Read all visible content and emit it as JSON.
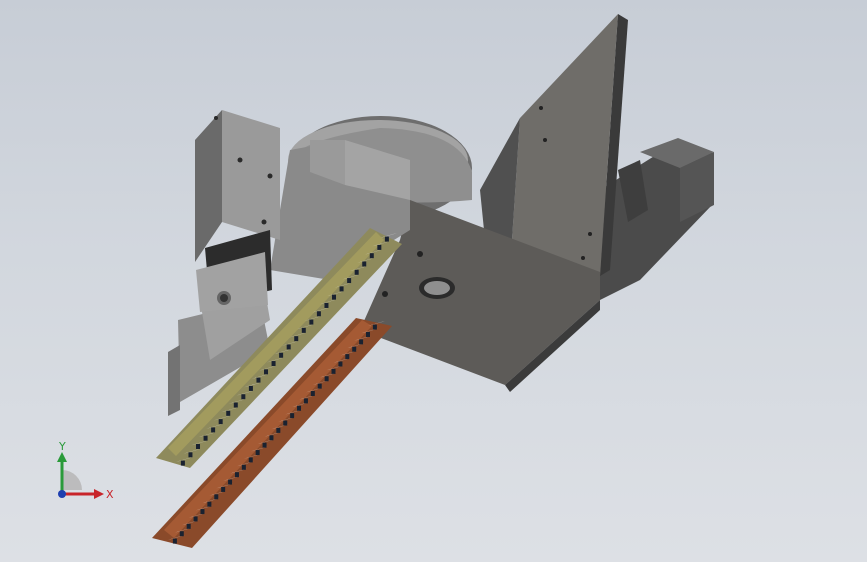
{
  "view": {
    "background_top": "#c7cdd6",
    "background_bottom": "#dde0e5"
  },
  "model": {
    "icon": "cad-assembly-model",
    "part_colors": {
      "housing": "#8a8a8a",
      "plate": "#6f6e6b",
      "green_strip": "#8e8a5c",
      "copper_strip": "#8a4a2a",
      "pins": "#f2f2f2",
      "pin_dark": "#1a2230"
    }
  },
  "triad": {
    "icon": "coordinate-triad-icon",
    "y_label": "Y",
    "x_label": "X",
    "y_color": "#2a9a3a",
    "x_color": "#c8242a",
    "z_color": "#1f3fb0"
  }
}
